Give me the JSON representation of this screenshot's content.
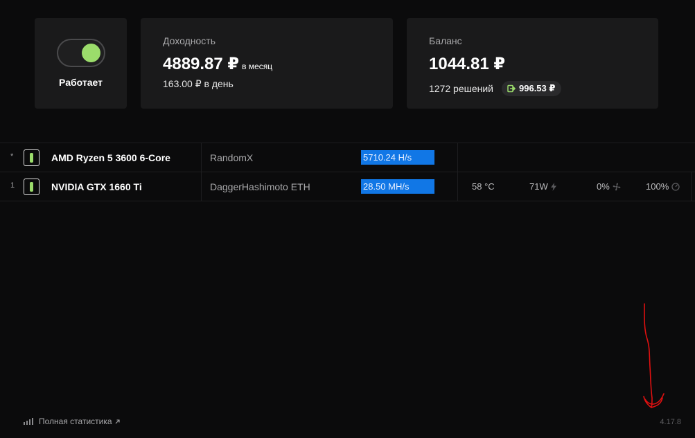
{
  "status": {
    "label": "Работает",
    "toggle_on": true
  },
  "income": {
    "title": "Доходность",
    "monthly_value": "4889.87 ₽",
    "monthly_unit": "в месяц",
    "daily": "163.00 ₽ в день"
  },
  "balance": {
    "title": "Баланс",
    "value": "1044.81 ₽",
    "solutions": "1272 решений",
    "withdraw_amount": "996.53 ₽"
  },
  "devices": [
    {
      "index": "*",
      "name": "AMD Ryzen 5 3600 6-Core",
      "algorithm": "RandomX",
      "hashrate": "5710.24 H/s"
    },
    {
      "index": "1",
      "name": "NVIDIA GTX 1660 Ti",
      "algorithm": "DaggerHashimoto ETH",
      "hashrate": "28.50 MH/s",
      "temperature": "58 °C",
      "power": "71W",
      "fan": "0%",
      "load": "100%"
    }
  ],
  "footer": {
    "stats_link": "Полная статистика",
    "version": "4.17.8"
  },
  "colors": {
    "accent_green": "#9bdc6b",
    "hashrate_blue": "#1177e6",
    "annotation_red": "#e01010"
  },
  "icons": {
    "withdraw": "exit-arrow-icon",
    "power": "lightning-icon",
    "fan": "fan-icon",
    "load": "gauge-icon",
    "stats": "bar-chart-icon",
    "external": "external-link-icon"
  }
}
